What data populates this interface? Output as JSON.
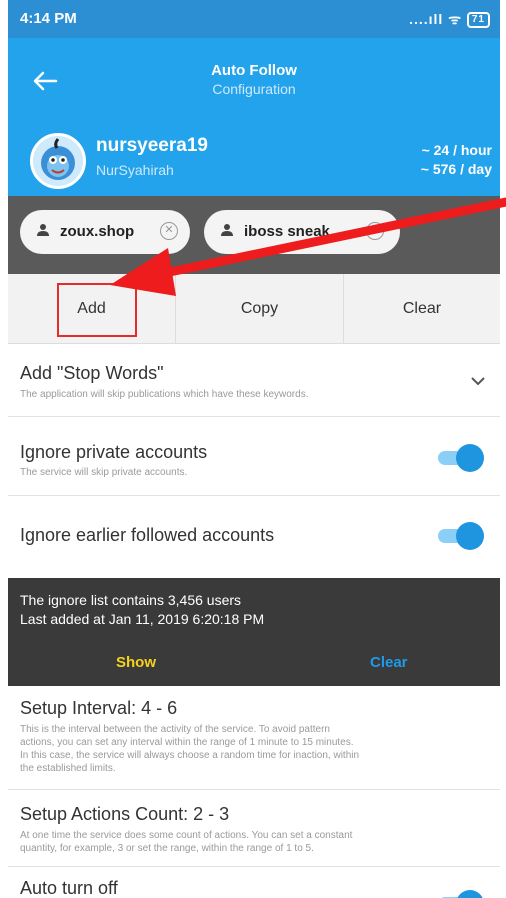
{
  "status_bar": {
    "time": "4:14 PM",
    "signal": "....ıll",
    "battery": "71"
  },
  "header": {
    "title": "Auto Follow",
    "subtitle": "Configuration",
    "username": "nursyeera19",
    "full_name": "NurSyahirah",
    "rate_hour": "~ 24 / hour",
    "rate_day": "~ 576 / day",
    "accent_color": "#23a3ec"
  },
  "chips": [
    {
      "label": "zoux.shop"
    },
    {
      "label": "iboss sneak"
    }
  ],
  "actions": {
    "add": "Add",
    "copy": "Copy",
    "clear": "Clear"
  },
  "settings": {
    "stop_words": {
      "title": "Add \"Stop Words\"",
      "subtitle": "The application will skip publications which have these keywords."
    },
    "private": {
      "title": "Ignore private accounts",
      "subtitle": "The service will skip private accounts.",
      "enabled": true
    },
    "earlier": {
      "title": "Ignore earlier followed accounts",
      "enabled": true
    }
  },
  "ignore_list": {
    "count_text": "The ignore list contains 3,456 users",
    "last_added": "Last added at Jan 11, 2019 6:20:18 PM",
    "show_label": "Show",
    "clear_label": "Clear"
  },
  "interval": {
    "title": "Setup Interval: 4 - 6",
    "lines": [
      "This is the interval between the activity of the service. To avoid pattern",
      "actions, you can set any interval within the range of 1 minute to 15 minutes.",
      "In this case, the service will always choose a random time for inaction, within",
      "the established limits."
    ]
  },
  "actions_count": {
    "title": "Setup Actions Count: 2 - 3",
    "lines": [
      "At one time the service does some count of actions. You can set a constant",
      "quantity, for example, 3 or set the range, within the range of 1 to 5."
    ]
  },
  "auto_turn_off": {
    "title": "Auto turn off"
  }
}
